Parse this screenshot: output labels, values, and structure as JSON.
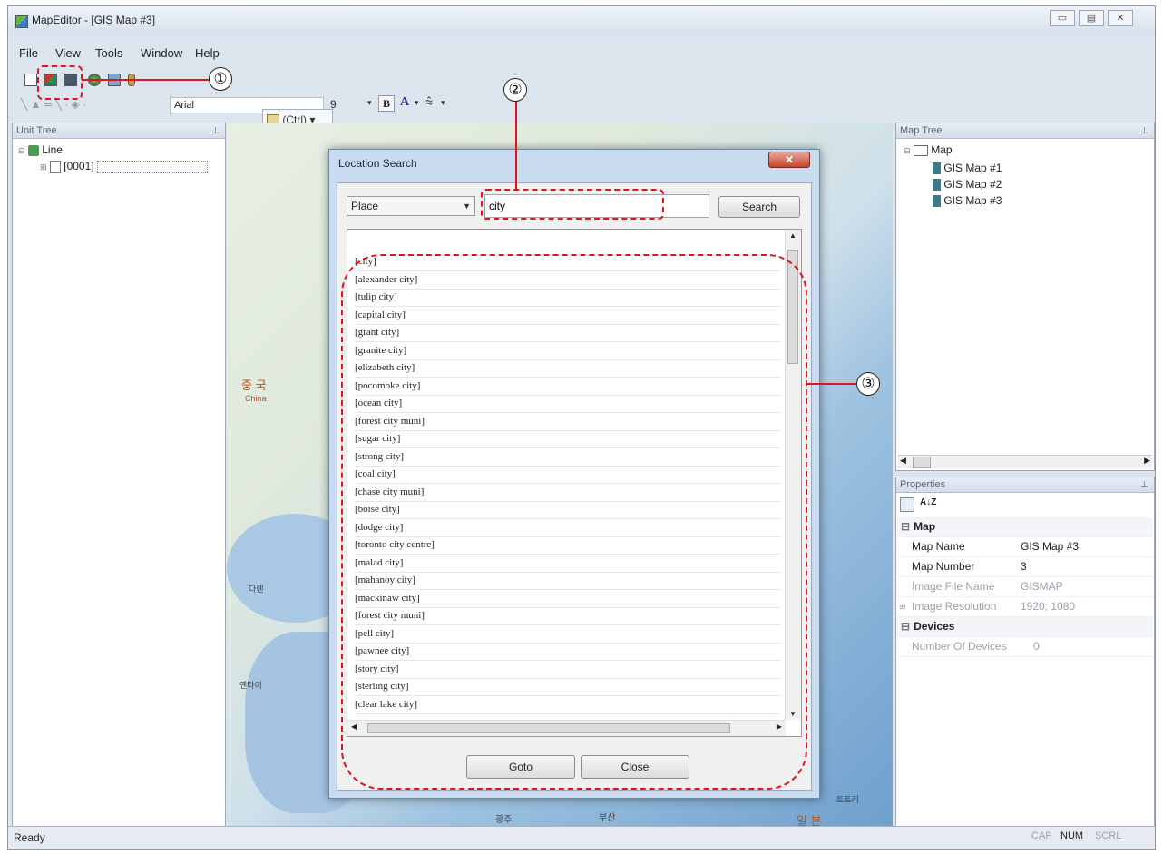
{
  "window": {
    "title": "MapEditor - [GIS Map #3]",
    "controls": [
      "▭",
      "▤",
      "✕"
    ]
  },
  "menu": [
    {
      "name": "menu-file",
      "label": "File"
    },
    {
      "name": "menu-view",
      "label": "View"
    },
    {
      "name": "menu-tools",
      "label": "Tools"
    },
    {
      "name": "menu-window",
      "label": "Window"
    },
    {
      "name": "menu-help",
      "label": "Help"
    }
  ],
  "toolbar": {
    "font_name": "Arial",
    "font_size": "9",
    "paste_label": "(Ctrl)",
    "bold": "B",
    "font_color": "A"
  },
  "unit_tree": {
    "title": "Unit Tree",
    "root": "Line",
    "child": "[0001]"
  },
  "map": {
    "label_china_kr": "중 국",
    "label_china": "China",
    "label_b": "다롄",
    "label_c": "옌타이",
    "label_d": "광주",
    "label_e": "부산",
    "label_f": "토토리",
    "label_japan": "일 본"
  },
  "dialog": {
    "title": "Location Search",
    "close": "✕",
    "search_type": "Place",
    "search_text": "city",
    "search_button": "Search",
    "goto_button": "Goto",
    "close_button": "Close",
    "results": [
      "[city]",
      "[alexander city]",
      "[tulip city]",
      "[capital city]",
      "[grant city]",
      "[granite city]",
      "[elizabeth city]",
      "[pocomoke city]",
      "[ocean city]",
      "[forest city muni]",
      "[sugar city]",
      "[strong city]",
      "[coal city]",
      "[chase city muni]",
      "[boise city]",
      "[dodge city]",
      "[toronto city centre]",
      "[malad city]",
      "[mahanoy city]",
      "[mackinaw city]",
      "[forest city muni]",
      "[pell city]",
      "[pawnee city]",
      "[story city]",
      "[sterling city]",
      "[clear lake city]"
    ]
  },
  "map_tree": {
    "title": "Map Tree",
    "root": "Map",
    "items": [
      "GIS Map #1",
      "GIS Map #2",
      "GIS Map #3"
    ]
  },
  "properties": {
    "title": "Properties",
    "sort_label": "A↓Z",
    "sections": [
      {
        "name": "Map",
        "rows": [
          {
            "key": "Map Name",
            "value": "GIS Map #3"
          },
          {
            "key": "Map Number",
            "value": "3"
          },
          {
            "key": "Image File Name",
            "value": "GISMAP"
          },
          {
            "key": "Image Resolution",
            "value": "1920; 1080"
          }
        ]
      },
      {
        "name": "Devices",
        "rows": [
          {
            "key": "Number Of Devices",
            "value": "0"
          }
        ]
      }
    ]
  },
  "status": {
    "text": "Ready",
    "cap": "CAP",
    "num": "NUM",
    "scrl": "SCRL"
  },
  "callouts": [
    "①",
    "②",
    "③"
  ]
}
